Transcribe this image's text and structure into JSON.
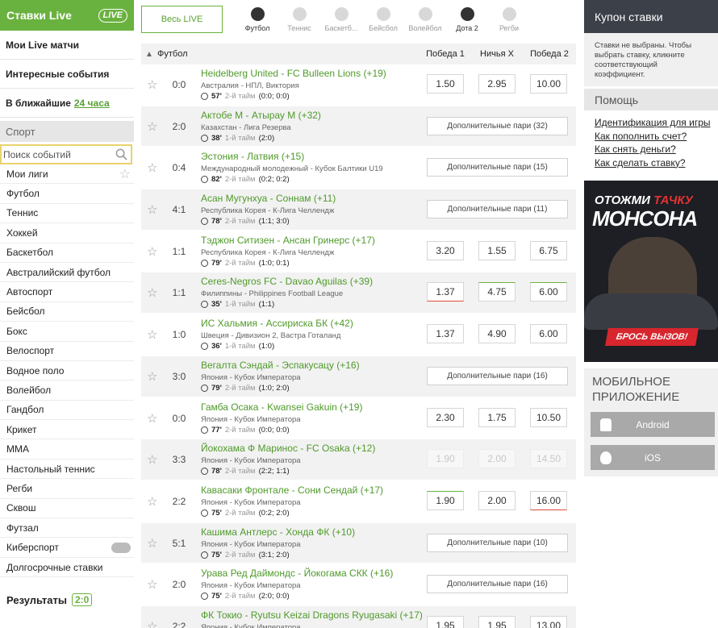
{
  "left": {
    "live_title": "Ставки Live",
    "live_logo": "LIVE",
    "nav": {
      "my_live": "Мои Live матчи",
      "interesting": "Интересные события",
      "nearest": "В ближайшие",
      "nearest_link": "24 часа"
    },
    "sport_header": "Спорт",
    "search_placeholder": "Поиск событий",
    "sports": [
      "Мои лиги",
      "Футбол",
      "Теннис",
      "Хоккей",
      "Баскетбол",
      "Австралийский футбол",
      "Автоспорт",
      "Бейсбол",
      "Бокс",
      "Велоспорт",
      "Водное поло",
      "Волейбол",
      "Гандбол",
      "Крикет",
      "MMA",
      "Настольный теннис",
      "Регби",
      "Сквош",
      "Футзал",
      "Киберспорт",
      "Долгосрочные ставки"
    ],
    "results_label": "Результаты",
    "results_badge": "2:0"
  },
  "main": {
    "all_live": "Весь LIVE",
    "sport_tabs": [
      {
        "label": "Футбол",
        "icon": "soccer-ball-icon",
        "active": true
      },
      {
        "label": "Теннис",
        "icon": "tennis-ball-icon",
        "active": false
      },
      {
        "label": "Баскетб...",
        "icon": "basketball-icon",
        "active": false
      },
      {
        "label": "Бейсбол",
        "icon": "baseball-bat-icon",
        "active": false
      },
      {
        "label": "Волейбол",
        "icon": "volleyball-icon",
        "active": false
      },
      {
        "label": "Дота 2",
        "icon": "gamepad-icon",
        "active": true
      },
      {
        "label": "Регби",
        "icon": "rugby-ball-icon",
        "active": false
      }
    ],
    "table_header": {
      "sport": "Футбол",
      "win1": "Победа 1",
      "draw": "Ничья X",
      "win2": "Победа 2"
    },
    "matches": [
      {
        "score": "0:0",
        "title": "Heidelberg United - FC Bulleen Lions (+19)",
        "league": "Австралия - НПЛ, Виктория",
        "minute": "57'",
        "half": "2-й тайм",
        "sub": "(0:0; 0:0)",
        "odds": [
          "1.50",
          "2.95",
          "10.00"
        ],
        "odds_state": [
          "",
          "",
          ""
        ]
      },
      {
        "score": "2:0",
        "title": "Актобе М - Атырау М (+32)",
        "league": "Казахстан - Лига Резерва",
        "minute": "38'",
        "half": "1-й тайм",
        "sub": "(2:0)",
        "more": "Дополнительные пари (32)"
      },
      {
        "score": "0:4",
        "title": "Эстония - Латвия (+15)",
        "league": "Международный молодежный - Кубок Балтики U19",
        "minute": "82'",
        "half": "2-й тайм",
        "sub": "(0:2; 0:2)",
        "more": "Дополнительные пари (15)"
      },
      {
        "score": "4:1",
        "title": "Асан Мугунхуа - Соннам (+11)",
        "league": "Республика Корея - К-Лига Челлендж",
        "minute": "78'",
        "half": "2-й тайм",
        "sub": "(1:1; 3:0)",
        "more": "Дополнительные пари (11)"
      },
      {
        "score": "1:1",
        "title": "Тэджон Ситизен - Ансан Гринерс (+17)",
        "league": "Республика Корея - К-Лига Челлендж",
        "minute": "79'",
        "half": "2-й тайм",
        "sub": "(1:0; 0:1)",
        "odds": [
          "3.20",
          "1.55",
          "6.75"
        ],
        "odds_state": [
          "",
          "",
          ""
        ]
      },
      {
        "score": "1:1",
        "title": "Ceres-Negros FC - Davao Aguilas (+39)",
        "league": "Филиппины - Philippines Football League",
        "minute": "35'",
        "half": "1-й тайм",
        "sub": "(1:1)",
        "odds": [
          "1.37",
          "4.75",
          "6.00"
        ],
        "odds_state": [
          "down",
          "up",
          "up"
        ]
      },
      {
        "score": "1:0",
        "title": "ИС Хальмия - Ассириска БК (+42)",
        "league": "Швеция - Дивизион 2, Вастра Готаланд",
        "minute": "36'",
        "half": "1-й тайм",
        "sub": "(1:0)",
        "odds": [
          "1.37",
          "4.90",
          "6.00"
        ],
        "odds_state": [
          "",
          "",
          ""
        ]
      },
      {
        "score": "3:0",
        "title": "Вегалта Сэндай - Эспакусацу (+16)",
        "league": "Япония - Кубок Императора",
        "minute": "79'",
        "half": "2-й тайм",
        "sub": "(1:0; 2:0)",
        "more": "Дополнительные пари (16)"
      },
      {
        "score": "0:0",
        "title": "Гамба Осака - Kwansei Gakuin (+19)",
        "league": "Япония - Кубок Императора",
        "minute": "77'",
        "half": "2-й тайм",
        "sub": "(0:0; 0:0)",
        "odds": [
          "2.30",
          "1.75",
          "10.50"
        ],
        "odds_state": [
          "",
          "",
          ""
        ]
      },
      {
        "score": "3:3",
        "title": "Йокохама Ф Маринос - FC Osaka (+12)",
        "league": "Япония - Кубок Императора",
        "minute": "78'",
        "half": "2-й тайм",
        "sub": "(2:2; 1:1)",
        "odds": [
          "1.90",
          "2.00",
          "14.50"
        ],
        "odds_state": [
          "dis",
          "dis",
          "dis"
        ]
      },
      {
        "score": "2:2",
        "title": "Кавасаки Фронтале - Сони Сендай (+17)",
        "league": "Япония - Кубок Императора",
        "minute": "75'",
        "half": "2-й тайм",
        "sub": "(0:2; 2:0)",
        "odds": [
          "1.90",
          "2.00",
          "16.00"
        ],
        "odds_state": [
          "up",
          "",
          "down"
        ]
      },
      {
        "score": "5:1",
        "title": "Кашима Антлерс - Хонда ФК (+10)",
        "league": "Япония - Кубок Императора",
        "minute": "75'",
        "half": "2-й тайм",
        "sub": "(3:1; 2:0)",
        "more": "Дополнительные пари (10)"
      },
      {
        "score": "2:0",
        "title": "Урава Ред Даймондс - Йокогама СКК (+16)",
        "league": "Япония - Кубок Императора",
        "minute": "75'",
        "half": "2-й тайм",
        "sub": "(2:0; 0:0)",
        "more": "Дополнительные пари (16)"
      },
      {
        "score": "2:2",
        "title": "ФК Токио - Ryutsu Keizai Dragons Ryugasaki (+17)",
        "league": "Япония - Кубок Императора",
        "minute": "",
        "half": "",
        "sub": "",
        "odds": [
          "1.95",
          "1.95",
          "13.00"
        ],
        "odds_state": [
          "",
          "",
          ""
        ]
      }
    ]
  },
  "right": {
    "coupon_title": "Купон ставки",
    "coupon_text": "Ставки не выбраны. Чтобы выбрать ставку, кликните соответствующий коэффициент.",
    "help_title": "Помощь",
    "help_links": [
      "Идентификация для игры",
      "Как пополнить счет?",
      "Как снять деньги?",
      "Как сделать ставку?"
    ],
    "promo": {
      "line1a": "ОТОЖМИ",
      "line1b": "ТАЧКУ",
      "line2": "МОНСОНА",
      "cta": "БРОСЬ ВЫЗОВ!"
    },
    "app_title": "МОБИЛЬНОЕ ПРИЛОЖЕНИЕ",
    "android": "Android",
    "ios": "iOS"
  },
  "colors": {
    "brand_green": "#6ab23f",
    "dark": "#3c4048",
    "odd_up": "#6ab23f",
    "odd_down": "#e04a3b"
  }
}
